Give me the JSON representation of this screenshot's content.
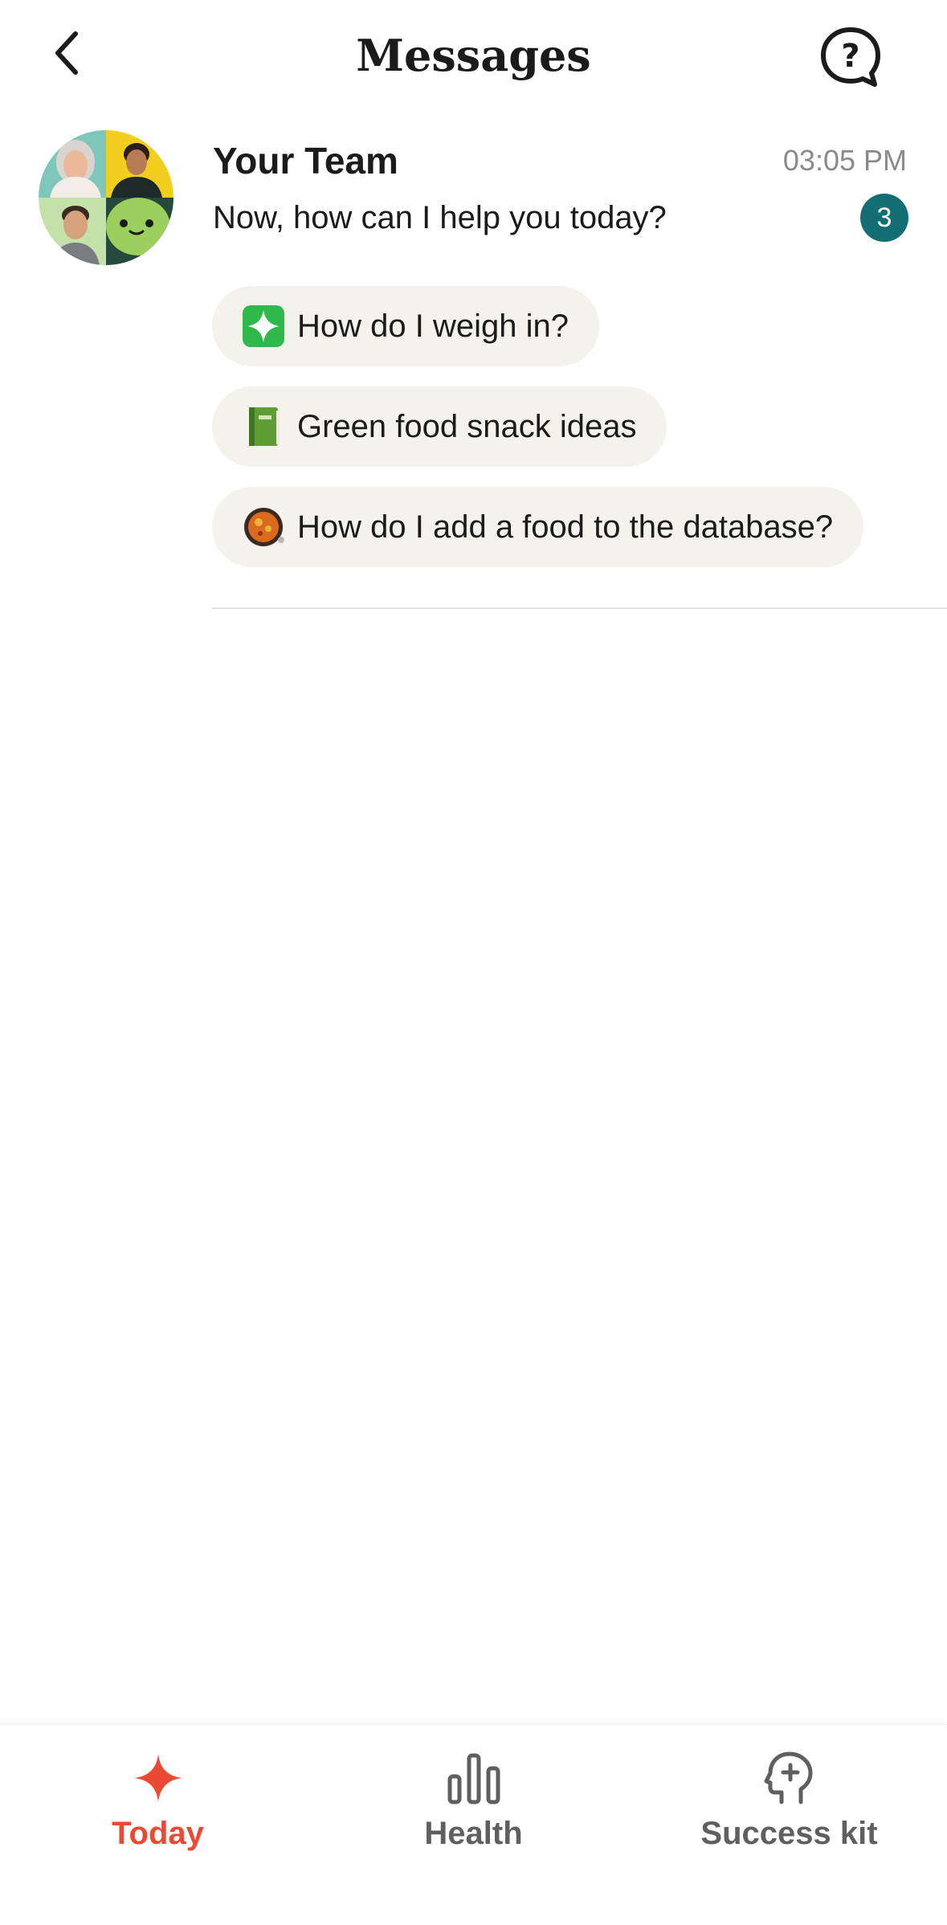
{
  "header": {
    "title": "Messages"
  },
  "conversation": {
    "name": "Your Team",
    "time": "03:05 PM",
    "preview": "Now, how can I help you today?",
    "unread_count": "3",
    "suggestions": [
      {
        "icon": "sparkle-icon",
        "label": "How do I weigh in?"
      },
      {
        "icon": "green-book-icon",
        "label": "Green food snack ideas"
      },
      {
        "icon": "food-pan-icon",
        "label": "How do I add a food to the database?"
      }
    ]
  },
  "bottom_nav": {
    "items": [
      {
        "label": "Today",
        "icon": "sparkle-icon",
        "active": true
      },
      {
        "label": "Health",
        "icon": "bar-chart-icon",
        "active": false
      },
      {
        "label": "Success kit",
        "icon": "head-plus-icon",
        "active": false
      }
    ]
  },
  "colors": {
    "accent": "#ea4a33",
    "badge": "#136e73",
    "chip_bg": "#f3f2ec",
    "nav_inactive": "#5f5f5f"
  }
}
